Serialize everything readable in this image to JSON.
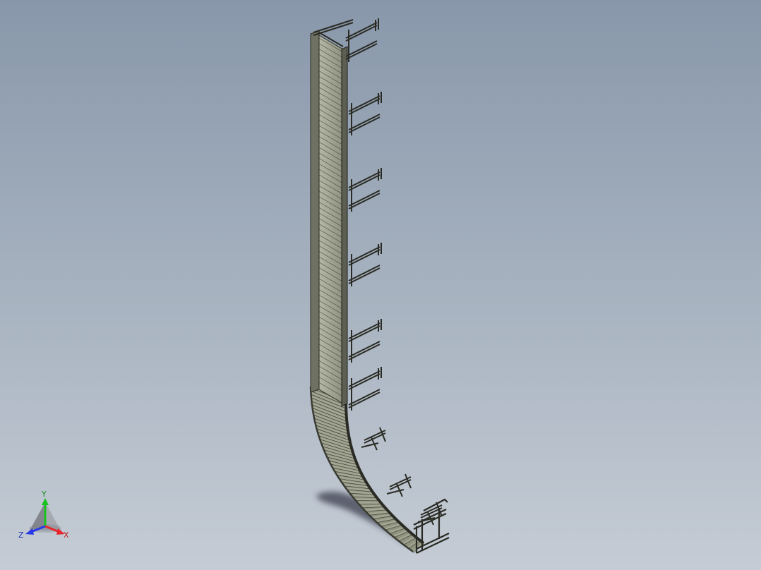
{
  "viewport": {
    "background_top": "#8897aa",
    "background_bottom": "#c5ccd5"
  },
  "model": {
    "frame_color": "#7d7f6e",
    "roller_color": "#a3a693",
    "edge_color": "#2a2b24",
    "shadow_color": "#3c4150",
    "straight_support_count": 6,
    "curved_support_count": 3,
    "straight_roller_count": 64,
    "curved_roller_count": 46
  },
  "triad": {
    "x_label": "X",
    "y_label": "Y",
    "z_label": "Z",
    "x_color": "#e8262b",
    "y_color": "#19c21e",
    "z_color": "#2638e8"
  }
}
